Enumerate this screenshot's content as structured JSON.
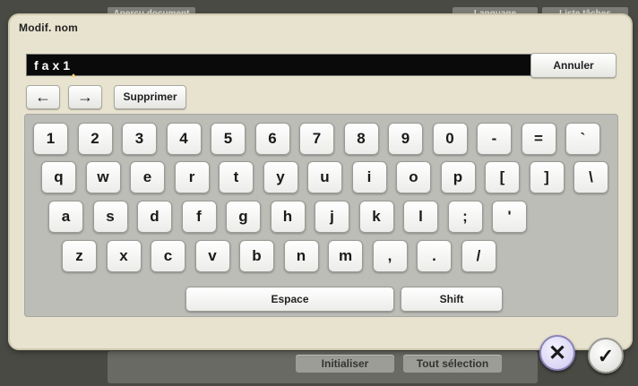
{
  "background": {
    "tab_left": "Aperçu document",
    "tab_right1": "Language",
    "tab_right2": "Liste tâches",
    "btn_initialiser": "Initialiser",
    "btn_tout_selection": "Tout sélection"
  },
  "dialog": {
    "title": "Modif. nom",
    "field_value": "fax1",
    "cancel_label": "Annuler",
    "left_arrow": "←",
    "right_arrow": "→",
    "delete_label": "Supprimer"
  },
  "keyboard": {
    "row1": [
      "1",
      "2",
      "3",
      "4",
      "5",
      "6",
      "7",
      "8",
      "9",
      "0",
      "-",
      "=",
      "`"
    ],
    "row2": [
      "q",
      "w",
      "e",
      "r",
      "t",
      "y",
      "u",
      "i",
      "o",
      "p",
      "[",
      "]",
      "\\"
    ],
    "row3": [
      "a",
      "s",
      "d",
      "f",
      "g",
      "h",
      "j",
      "k",
      "l",
      ";",
      "'"
    ],
    "row4": [
      "z",
      "x",
      "c",
      "v",
      "b",
      "n",
      "m",
      ",",
      ".",
      "/"
    ],
    "space_label": "Espace",
    "shift_label": "Shift"
  },
  "actions": {
    "close_symbol": "✕",
    "ok_symbol": "✓"
  },
  "colors": {
    "dialog_bg": "#e8e3cf",
    "panel_bg": "#bdbdb8",
    "field_bg": "#0a0a0a"
  }
}
